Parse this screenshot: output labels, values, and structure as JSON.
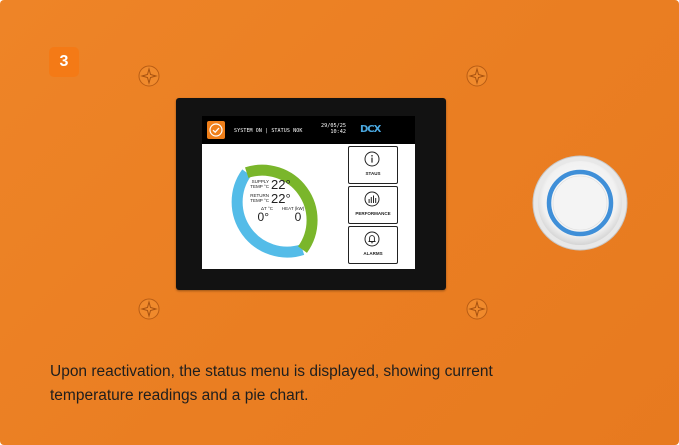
{
  "step": {
    "number": "3"
  },
  "screen": {
    "status_text": "SYSTEM ON  |  STATUS NOK",
    "date": "29/05/25",
    "time": "10:42",
    "logo": "DCX",
    "supply_label_1": "SUPPLY",
    "supply_label_2": "TEMP °C",
    "supply_value": "22°",
    "return_label_1": "RETURN",
    "return_label_2": "TEMP °C",
    "return_value": "22°",
    "delta_label": "ΔT °C",
    "heat_label": "HEAT (kW)",
    "delta_value": "0°",
    "heat_value": "0",
    "buttons": [
      {
        "label": "STAUS",
        "icon": "info-icon"
      },
      {
        "label": "PERFORMANCE",
        "icon": "bar-chart-icon"
      },
      {
        "label": "ALARMS",
        "icon": "bell-icon"
      }
    ],
    "gauge_colors": {
      "green": "#7ab62b",
      "blue": "#54bce8"
    }
  },
  "caption": {
    "line1": "Upon reactivation, the status menu is displayed, showing current",
    "line2": "temperature readings and a pie chart."
  },
  "colors": {
    "panel": "#ea7e22",
    "badge": "#f47a16",
    "knob_ring": "#3f8fd8"
  }
}
